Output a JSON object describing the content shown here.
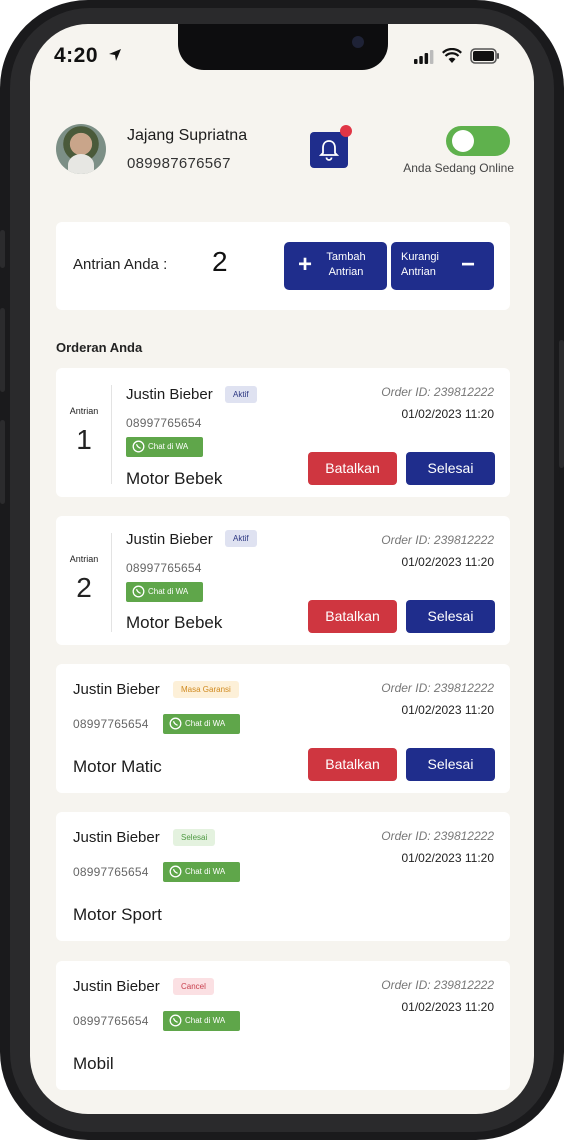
{
  "status_bar": {
    "time": "4:20"
  },
  "profile": {
    "name": "Jajang Supriatna",
    "phone": "089987676567",
    "online_label": "Anda Sedang Online"
  },
  "queue": {
    "label": "Antrian Anda :",
    "count": "2",
    "add_label": "Tambah Antrian",
    "sub_label": "Kurangi Antrian"
  },
  "section_title": "Orderan Anda",
  "orders": [
    {
      "antrian_caption": "Antrian",
      "antrian": "1",
      "name": "Justin Bieber",
      "badge": "Aktif",
      "phone": "08997765654",
      "wa_label": "Chat di WA",
      "vehicle": "Motor Bebek",
      "order_id": "Order ID: 239812222",
      "date": "01/02/2023 11:20",
      "cancel_label": "Batalkan",
      "done_label": "Selesai"
    },
    {
      "antrian_caption": "Antrian",
      "antrian": "2",
      "name": "Justin Bieber",
      "badge": "Aktif",
      "phone": "08997765654",
      "wa_label": "Chat di WA",
      "vehicle": "Motor Bebek",
      "order_id": "Order ID: 239812222",
      "date": "01/02/2023 11:20",
      "cancel_label": "Batalkan",
      "done_label": "Selesai"
    },
    {
      "name": "Justin Bieber",
      "badge": "Masa Garansi",
      "phone": "08997765654",
      "wa_label": "Chat di WA",
      "vehicle": "Motor Matic",
      "order_id": "Order ID: 239812222",
      "date": "01/02/2023 11:20",
      "cancel_label": "Batalkan",
      "done_label": "Selesai"
    },
    {
      "name": "Justin Bieber",
      "badge": "Selesai",
      "phone": "08997765654",
      "wa_label": "Chat di WA",
      "vehicle": "Motor Sport",
      "order_id": "Order ID: 239812222",
      "date": "01/02/2023 11:20"
    },
    {
      "name": "Justin Bieber",
      "badge": "Cancel",
      "phone": "08997765654",
      "wa_label": "Chat di WA",
      "vehicle": "Mobil",
      "order_id": "Order ID: 239812222",
      "date": "01/02/2023 11:20"
    }
  ],
  "colors": {
    "primary": "#1f2d8c",
    "danger": "#cf3640",
    "success": "#5fb14d",
    "badge_aktif_bg": "#dfe2f1",
    "badge_aktif_fg": "#2a3580",
    "badge_garansi_bg": "#fdf0d8",
    "badge_garansi_fg": "#d08a20",
    "badge_selesai_bg": "#e4f2df",
    "badge_selesai_fg": "#4f9a43",
    "badge_cancel_bg": "#fbe0e3",
    "badge_cancel_fg": "#c8404e"
  }
}
